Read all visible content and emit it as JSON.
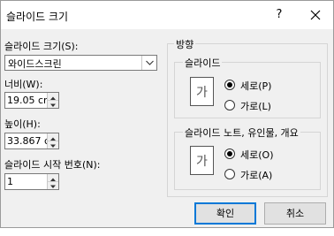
{
  "window": {
    "title": "슬라이드 크기",
    "help": "?"
  },
  "size": {
    "label": "슬라이드 크기(S):",
    "selected": "와이드스크린"
  },
  "width": {
    "label": "너비(W):",
    "value": "19.05 cm"
  },
  "height": {
    "label": "높이(H):",
    "value": "33.867 cm"
  },
  "start_number": {
    "label": "슬라이드 시작 번호(N):",
    "value": "1"
  },
  "orientation": {
    "group_title": "방향",
    "slides": {
      "title": "슬라이드",
      "icon_letter": "가",
      "portrait": "세로(P)",
      "landscape": "가로(L)",
      "selected": "portrait"
    },
    "notes": {
      "title": "슬라이드 노트, 유인물, 개요",
      "icon_letter": "가",
      "portrait": "세로(O)",
      "landscape": "가로(A)",
      "selected": "portrait"
    }
  },
  "buttons": {
    "ok": "확인",
    "cancel": "취소"
  },
  "colors": {
    "accent": "#0078d7",
    "dialog_bg": "#f0f0f0"
  }
}
